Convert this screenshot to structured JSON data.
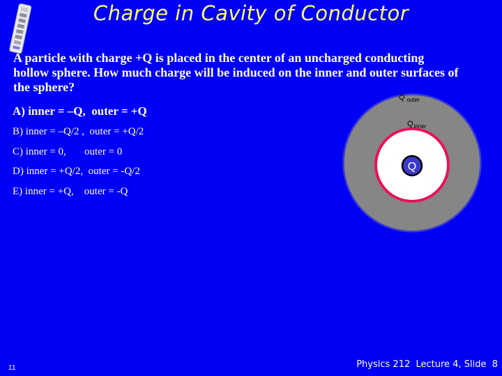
{
  "slide": {
    "title": "Charge in Cavity of Conductor",
    "question": "A particle with charge +Q is placed in the center of an uncharged conducting hollow sphere. How much charge will be induced on the inner and outer surfaces of the sphere?",
    "options": [
      {
        "id": "A",
        "label": "A) inner = –Q,  outer = +Q"
      },
      {
        "id": "B",
        "label": "B) inner = –Q/2 ,  outer = +Q/2"
      },
      {
        "id": "C",
        "label": "C) inner = 0,       outer = 0"
      },
      {
        "id": "D",
        "label": "D) inner = +Q/2,  outer = -Q/2"
      },
      {
        "id": "E",
        "label": "E) inner = +Q,    outer = -Q"
      }
    ],
    "diagram": {
      "outer_label": "Q",
      "outer_subscript": "outer",
      "inner_label": "Q",
      "inner_subscript": "inner",
      "charge_label": "Q",
      "colors": {
        "conductor": "#868686",
        "conductor_edge": "#3a3ad0",
        "cavity": "#ffffff",
        "inner_surface": "#e8125a",
        "charge_fill": "#3a3acb",
        "charge_edge": "#000000"
      }
    },
    "page_number": "11",
    "footer": "Physics 212  Lecture 4, Slide  8",
    "logo_icon": "remote-control-icon"
  },
  "colors": {
    "background": "#0000f5",
    "title": "#ffff66",
    "text": "#ffffff"
  }
}
